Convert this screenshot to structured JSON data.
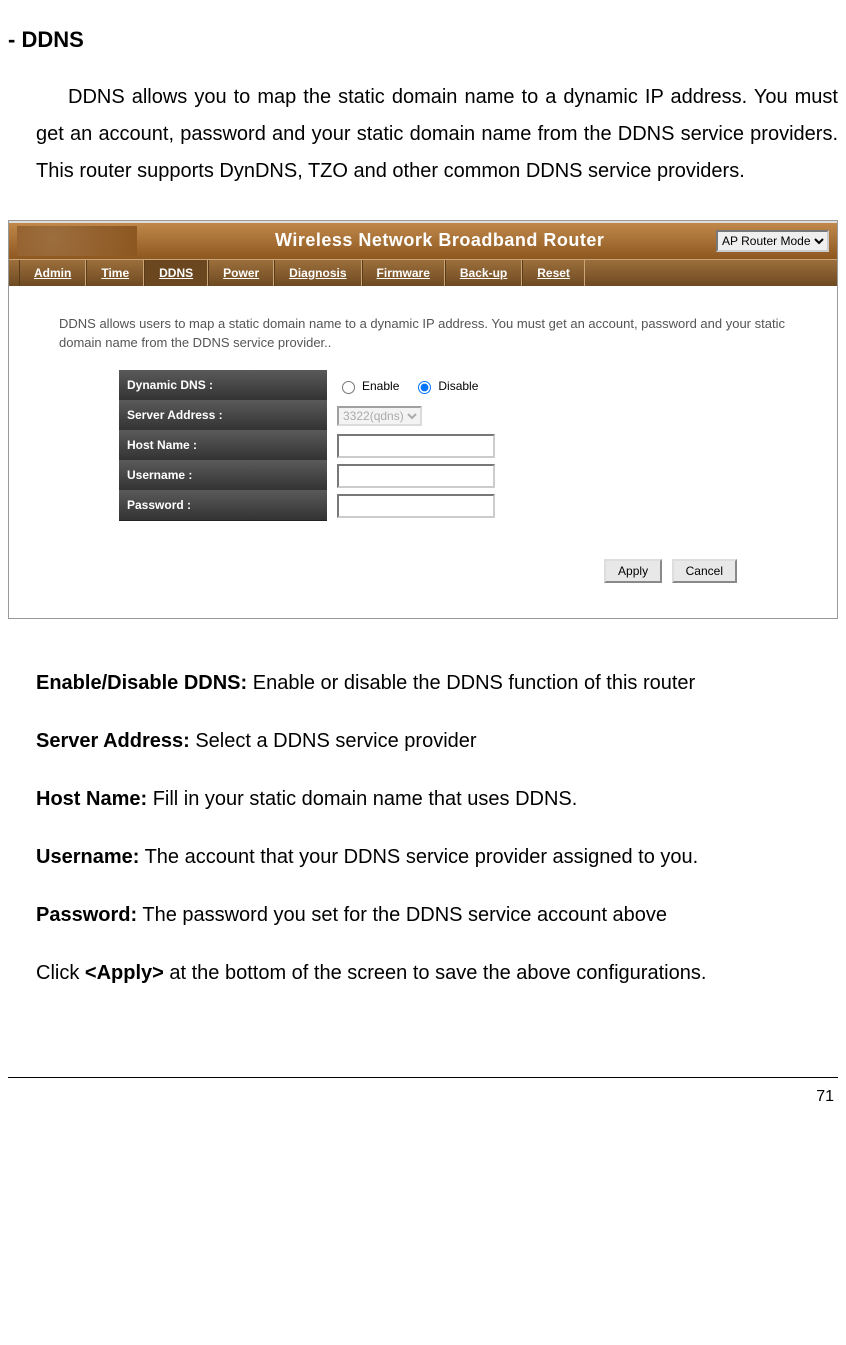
{
  "section_title": "- DDNS",
  "intro_text": "DDNS allows you to map the static domain name to a dynamic IP address. You must get an account, password and your static domain name from the DDNS service providers. This router supports DynDNS, TZO and other common DDNS service providers.",
  "screenshot": {
    "header_title": "Wireless Network Broadband Router",
    "mode_selected": "AP Router Mode",
    "nav": [
      "Admin",
      "Time",
      "DDNS",
      "Power",
      "Diagnosis",
      "Firmware",
      "Back-up",
      "Reset"
    ],
    "nav_active_index": 2,
    "note_text": "DDNS allows users to map a static domain name to a dynamic IP address. You must get an account, password and your static domain name from the DDNS service provider..",
    "form": {
      "dynamic_dns_label": "Dynamic DNS :",
      "enable_label": "Enable",
      "disable_label": "Disable",
      "radio_selected": "disable",
      "server_address_label": "Server Address :",
      "server_address_value": "3322(qdns)",
      "host_name_label": "Host Name :",
      "host_name_value": "",
      "username_label": "Username :",
      "username_value": "",
      "password_label": "Password :",
      "password_value": ""
    },
    "apply_button": "Apply",
    "cancel_button": "Cancel"
  },
  "definitions": {
    "enable_disable": {
      "label": "Enable/Disable DDNS:",
      "text": " Enable or disable the DDNS function of this router"
    },
    "server_address": {
      "label": "Server Address:",
      "text": " Select a DDNS service provider"
    },
    "host_name": {
      "label": "Host Name:",
      "text": " Fill in your static domain name that uses DDNS."
    },
    "username": {
      "label": "Username:",
      "text": " The account that your DDNS service provider assigned to you."
    },
    "password": {
      "label": "Password:",
      "text": " The password you set for the DDNS service account above"
    },
    "apply_pre": "Click ",
    "apply_tag": "<Apply>",
    "apply_post": " at the bottom of the screen to save the above configurations."
  },
  "page_number": "71"
}
